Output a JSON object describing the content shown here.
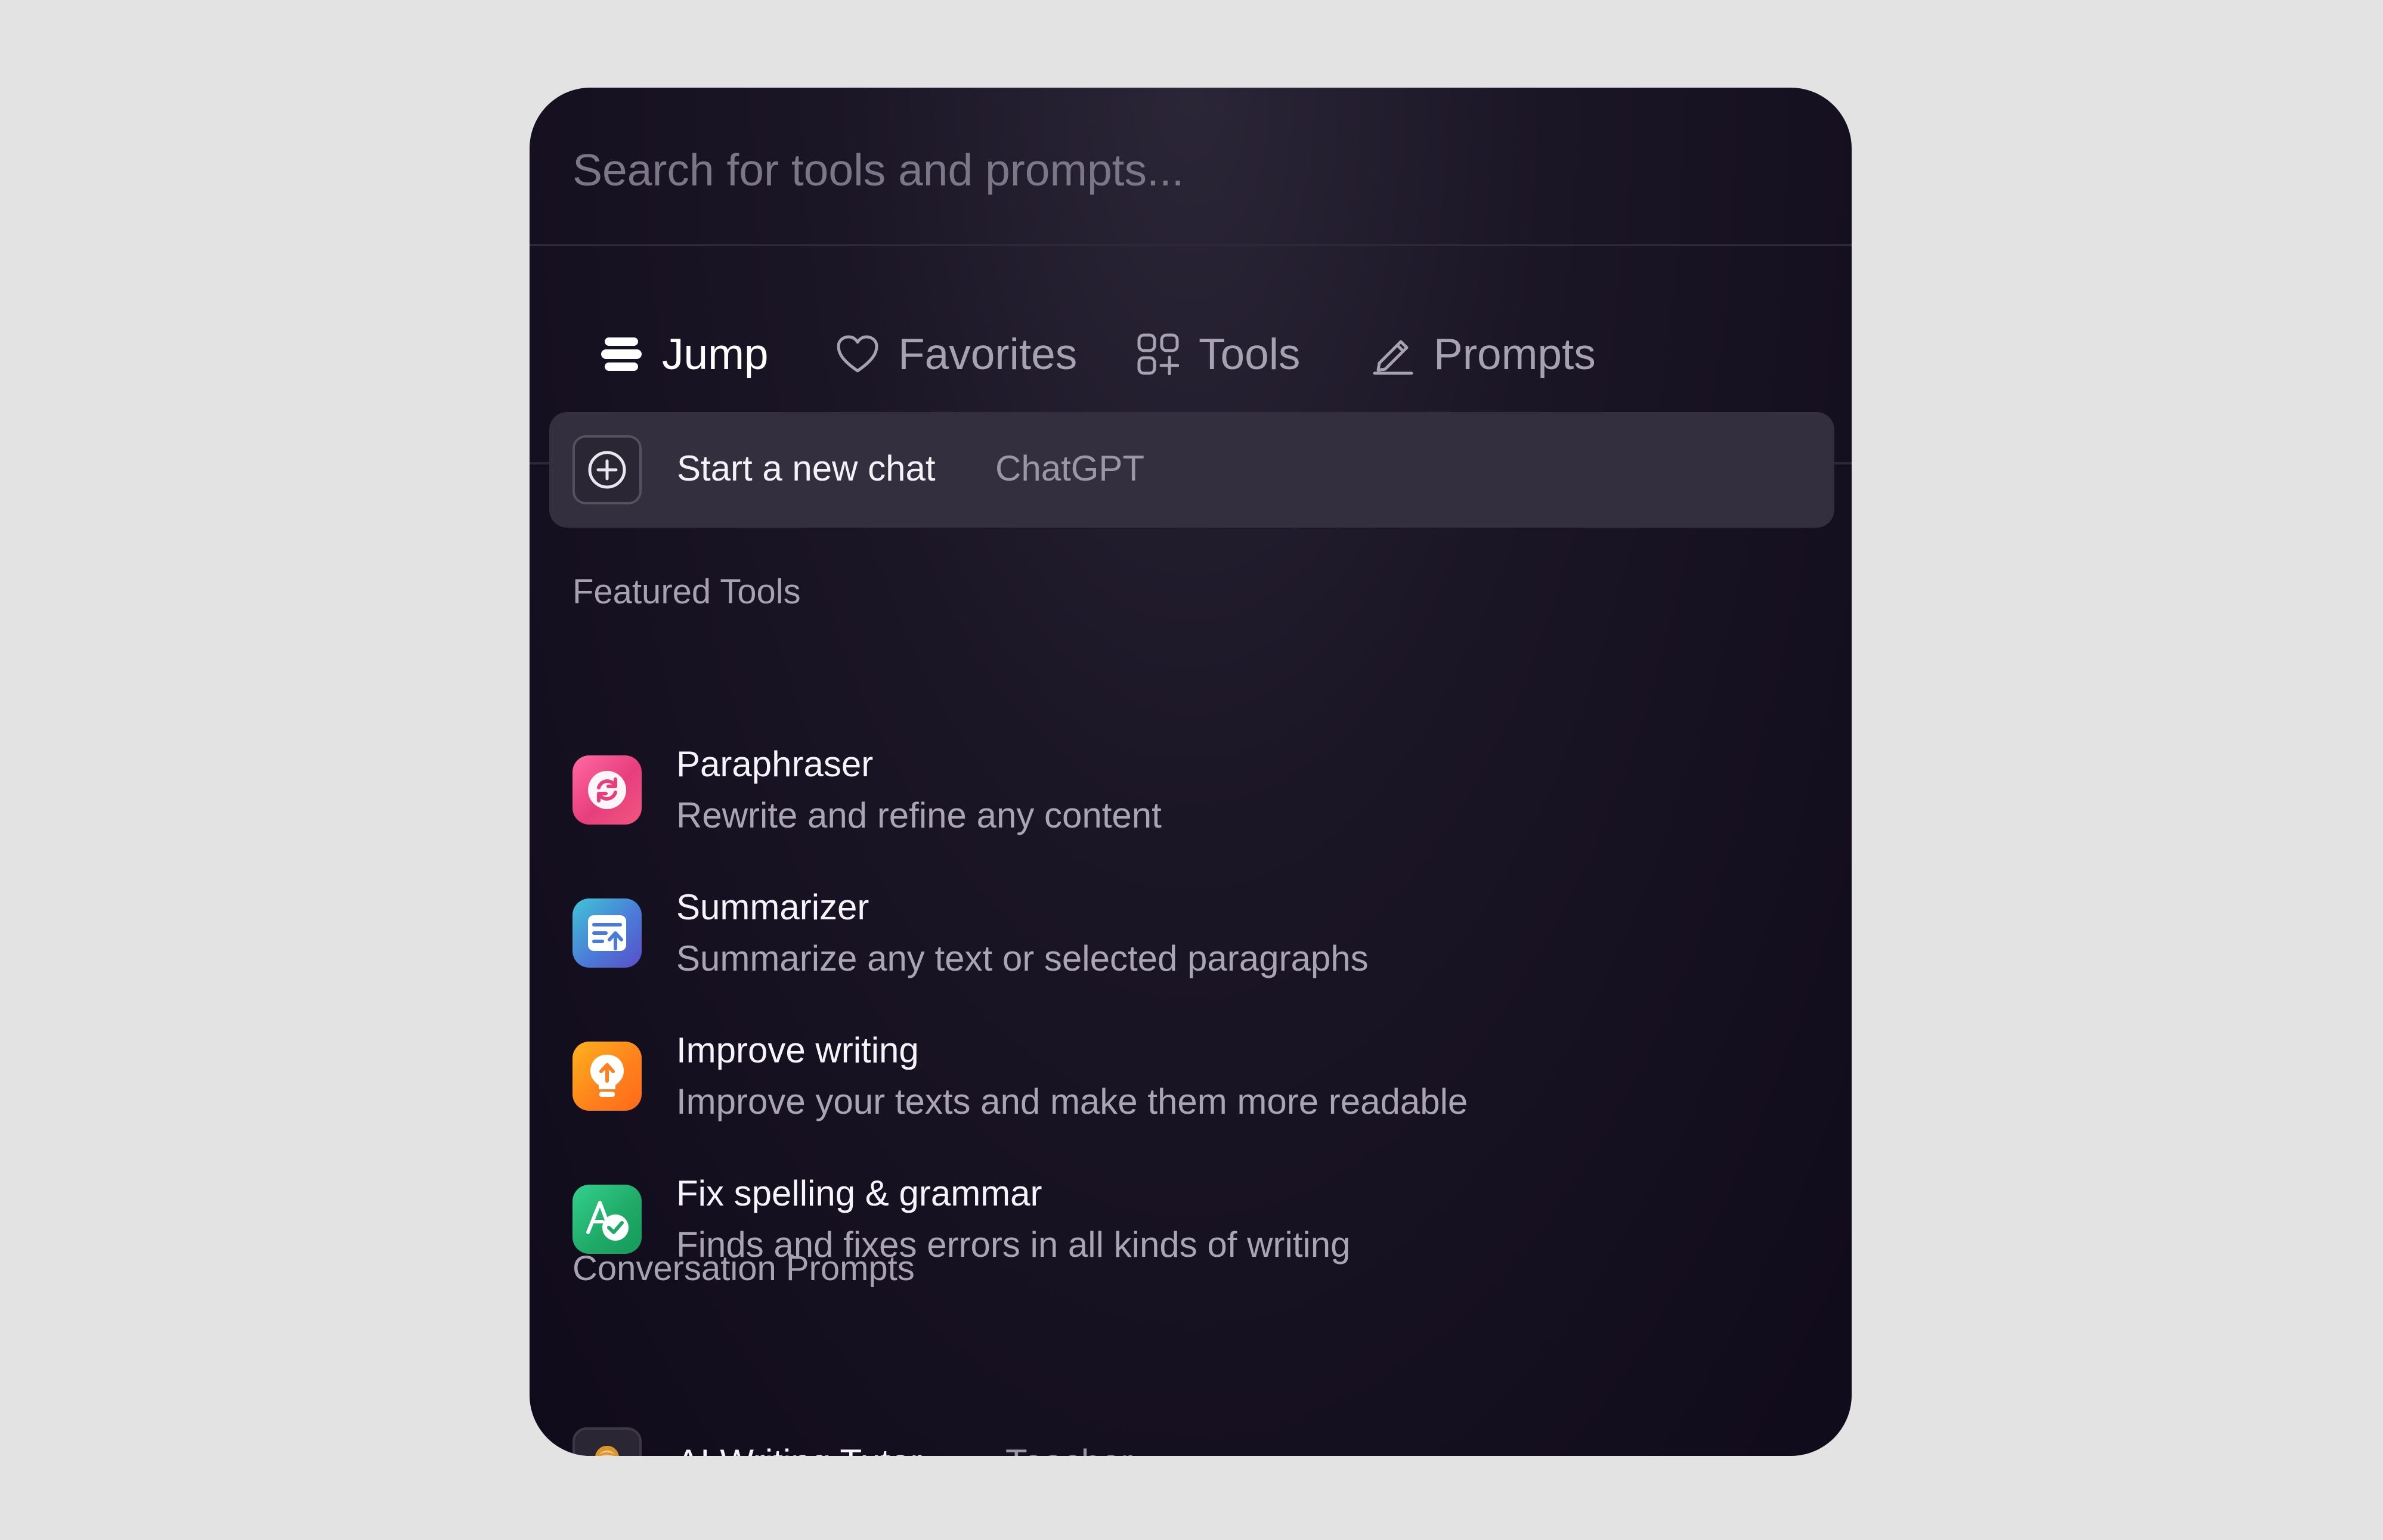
{
  "search": {
    "placeholder": "Search for tools and prompts..."
  },
  "tabs": [
    {
      "label": "Jump",
      "icon": "jump-icon",
      "active": true
    },
    {
      "label": "Favorites",
      "icon": "heart-icon",
      "active": false
    },
    {
      "label": "Tools",
      "icon": "grid-plus-icon",
      "active": false
    },
    {
      "label": "Prompts",
      "icon": "pencil-icon",
      "active": false
    }
  ],
  "new_chat": {
    "title": "Start a new chat",
    "subtitle": "ChatGPT",
    "icon": "plus-circle-icon"
  },
  "featured": {
    "heading": "Featured Tools",
    "items": [
      {
        "name": "Paraphraser",
        "description": "Rewrite and refine any content",
        "icon": "refresh-icon",
        "color": "#ee4a87"
      },
      {
        "name": "Summarizer",
        "description": "Summarize any text or selected paragraphs",
        "icon": "summary-upload-icon",
        "color": "#4b7bd8"
      },
      {
        "name": "Improve writing",
        "description": "Improve your texts and make them more readable",
        "icon": "lightbulb-icon",
        "color": "#ff8a1c"
      },
      {
        "name": "Fix spelling & grammar",
        "description": "Finds and fixes errors in all kinds of writing",
        "icon": "check-a-icon",
        "color": "#1fa866"
      }
    ]
  },
  "conversation": {
    "heading": "Conversation Prompts",
    "items": [
      {
        "name": "AI Writing Tutor",
        "role": "Teacher",
        "icon": "teacher-emoji-icon"
      }
    ]
  },
  "colors": {
    "page_background": "#e3e3e3",
    "panel_background": "#140f1f",
    "highlight_row": "#332f3e",
    "text_primary": "#f6f4fa",
    "text_secondary": "#a6a2b2"
  }
}
